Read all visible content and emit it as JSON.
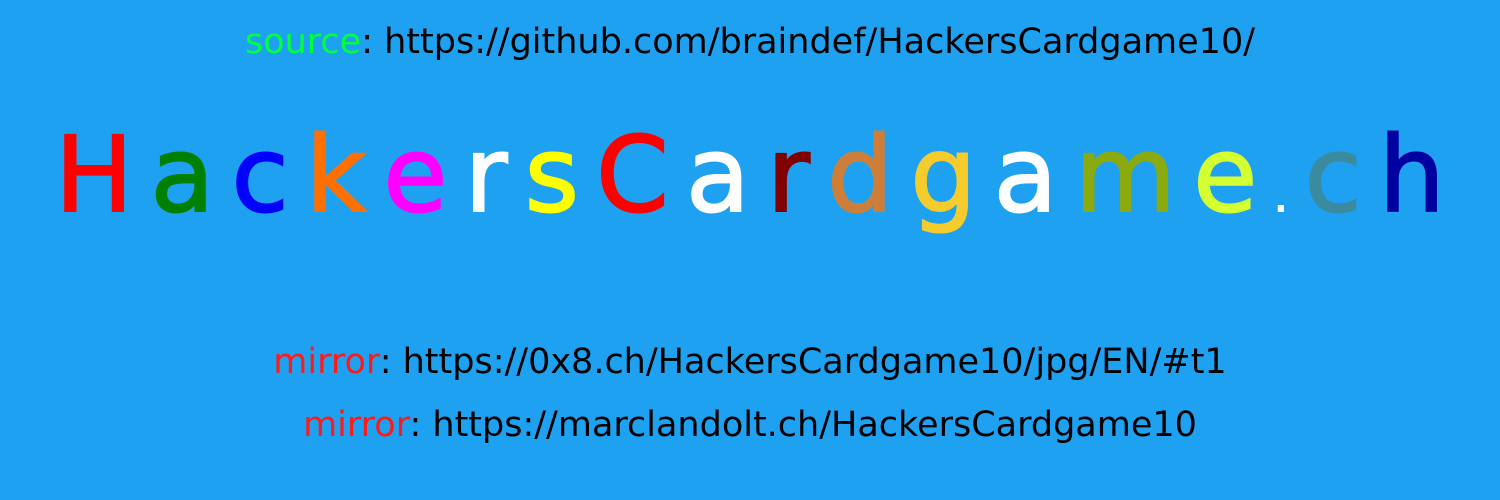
{
  "source": {
    "label": "source",
    "separator": ": ",
    "url": "https://github.com/braindef/HackersCardgame10/",
    "label_color": "#00ff3c"
  },
  "title": {
    "text": "HackersCardgame.ch",
    "letters": [
      {
        "ch": "H",
        "color": "#ff0000"
      },
      {
        "ch": "a",
        "color": "#008000"
      },
      {
        "ch": "c",
        "color": "#0000ff"
      },
      {
        "ch": "k",
        "color": "#ff7000"
      },
      {
        "ch": "e",
        "color": "#ff00ff"
      },
      {
        "ch": "r",
        "color": "#ffffff"
      },
      {
        "ch": "s",
        "color": "#ffff00"
      },
      {
        "ch": "C",
        "color": "#ff0000"
      },
      {
        "ch": "a",
        "color": "#ffffff"
      },
      {
        "ch": "r",
        "color": "#800000"
      },
      {
        "ch": "d",
        "color": "#cd7f3a"
      },
      {
        "ch": "g",
        "color": "#f6cb2c"
      },
      {
        "ch": "a",
        "color": "#ffffff"
      },
      {
        "ch": "m",
        "color": "#8aaa10"
      },
      {
        "ch": "e",
        "color": "#d4ff30"
      },
      {
        "ch": ".",
        "color": "#ffffff"
      },
      {
        "ch": "c",
        "color": "#3a8aa0"
      },
      {
        "ch": "h",
        "color": "#0000a0"
      }
    ]
  },
  "mirrors": [
    {
      "label": "mirror",
      "separator": ": ",
      "url": "https://0x8.ch/HackersCardgame10/jpg/EN/#t1",
      "label_color": "#ff1a1a"
    },
    {
      "label": "mirror",
      "separator": ": ",
      "url": "https://marclandolt.ch/HackersCardgame10",
      "label_color": "#ff1a1a"
    }
  ]
}
